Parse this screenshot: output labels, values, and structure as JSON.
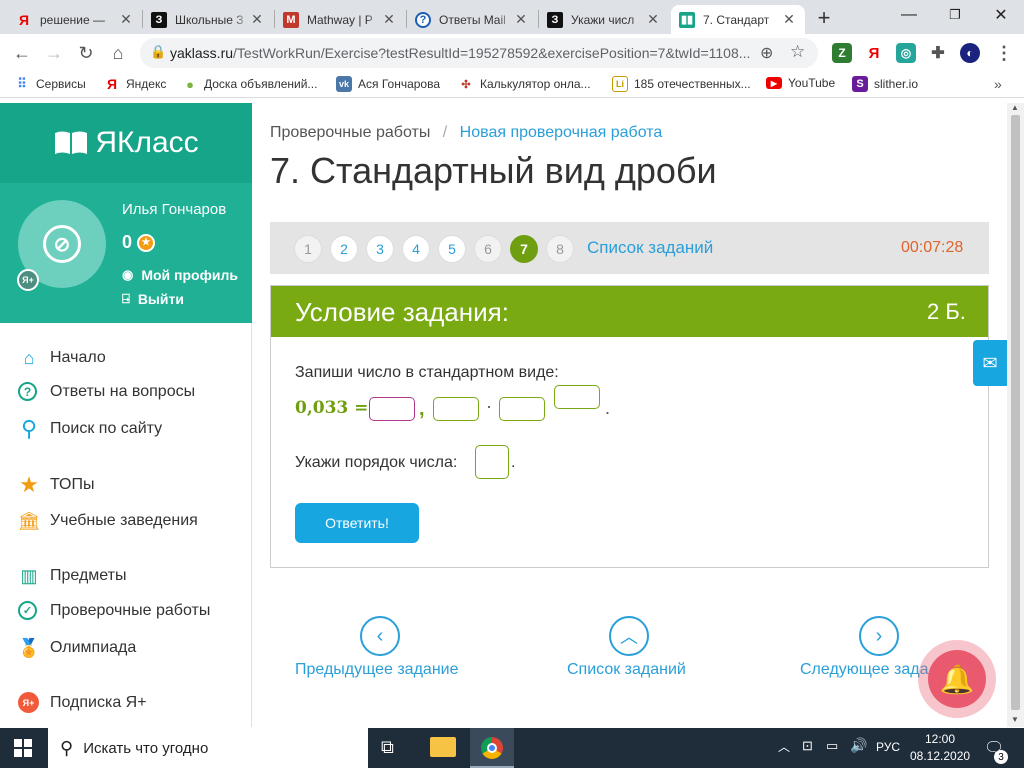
{
  "browser": {
    "tabs": [
      {
        "title": "решение — ",
        "icon": "yandex-icon"
      },
      {
        "title": "Школьные З",
        "icon": "znanija-icon"
      },
      {
        "title": "Mathway | Р",
        "icon": "mathway-icon"
      },
      {
        "title": "Ответы Mail",
        "icon": "question-icon"
      },
      {
        "title": "Укажи числ",
        "icon": "znanija-icon"
      },
      {
        "title": "7. Стандарт",
        "icon": "yaklass-icon"
      }
    ],
    "url_host": "yaklass.ru",
    "url_path": "/TestWorkRun/Exercise?testResultId=195278592&exercisePosition=7&twId=1108...",
    "bookmarks": [
      {
        "label": "Сервисы",
        "icon": "apps-icon"
      },
      {
        "label": "Яндекс",
        "icon": "yandex-icon"
      },
      {
        "label": "Доска объявлений...",
        "icon": "avito-icon"
      },
      {
        "label": "Ася Гончарова",
        "icon": "vk-icon"
      },
      {
        "label": "Калькулятор онла...",
        "icon": "calc-icon"
      },
      {
        "label": "185 отечественных...",
        "icon": "lit-icon"
      },
      {
        "label": "YouTube",
        "icon": "youtube-icon"
      },
      {
        "label": "slither.io",
        "icon": "slither-icon"
      }
    ]
  },
  "sidebar": {
    "logo": "ЯКласс",
    "user_name": "Илья Гончаров",
    "points": "0",
    "my_profile": "Мой профиль",
    "logout": "Выйти",
    "ya_plus": "Я+",
    "menu": [
      {
        "label": "Начало",
        "icon": "home-icon"
      },
      {
        "label": "Ответы на вопросы",
        "icon": "question-icon"
      },
      {
        "label": "Поиск по сайту",
        "icon": "search-icon"
      },
      {
        "label": "ТОПы",
        "icon": "star-icon"
      },
      {
        "label": "Учебные заведения",
        "icon": "school-icon"
      },
      {
        "label": "Предметы",
        "icon": "books-icon"
      },
      {
        "label": "Проверочные работы",
        "icon": "check-icon"
      },
      {
        "label": "Олимпиада",
        "icon": "medal-icon"
      },
      {
        "label": "Подписка Я+",
        "icon": "ya-plus-icon"
      }
    ]
  },
  "main": {
    "breadcrumb_root": "Проверочные работы",
    "breadcrumb_sep": "/",
    "breadcrumb_current": "Новая проверочная работа",
    "title": "7. Стандартный вид дроби",
    "task_numbers": [
      "1",
      "2",
      "3",
      "4",
      "5",
      "6",
      "7",
      "8"
    ],
    "current_task": "7",
    "task_list_link": "Список заданий",
    "timer": "00:07:28",
    "condition_header": "Условие задания:",
    "score": "2 Б.",
    "instruction": "Запиши число в стандартном виде:",
    "number": "0,033 =",
    "comma": ",",
    "dot": "·",
    "period": ".",
    "order_prompt": "Укажи порядок числа:",
    "submit": "Ответить!",
    "prev_task": "Предыдущее задание",
    "tasks_list": "Список заданий",
    "next_task": "Следующее зада"
  },
  "taskbar": {
    "search_placeholder": "Искать что угодно",
    "lang": "РУС",
    "time": "12:00",
    "date": "08.12.2020",
    "notifications": "3"
  }
}
